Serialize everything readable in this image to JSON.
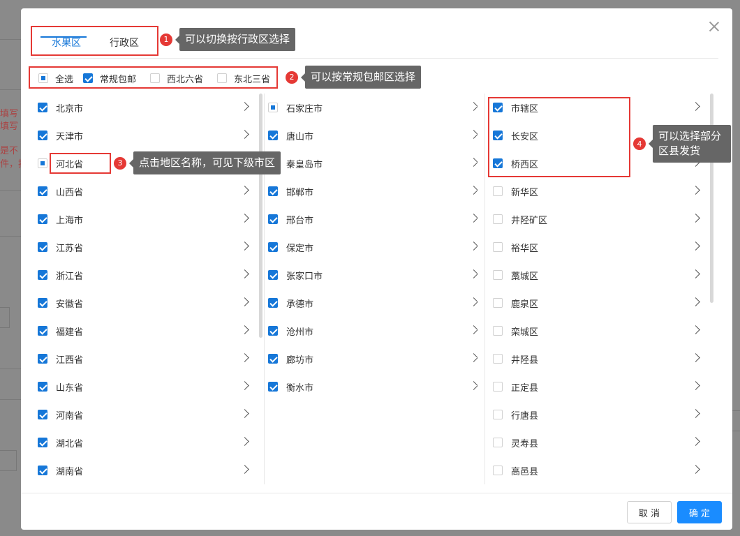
{
  "background": {
    "left_texts": [
      "填写",
      "填写",
      "是不",
      "件，按"
    ]
  },
  "tabs": [
    {
      "label": "水果区",
      "active": true
    },
    {
      "label": "行政区",
      "active": false
    }
  ],
  "filters": [
    {
      "label": "全选",
      "state": "partial"
    },
    {
      "label": "常规包邮",
      "state": "checked"
    },
    {
      "label": "西北六省",
      "state": "unchecked"
    },
    {
      "label": "东北三省",
      "state": "unchecked"
    }
  ],
  "provinces": [
    {
      "name": "北京市",
      "state": "checked"
    },
    {
      "name": "天津市",
      "state": "checked"
    },
    {
      "name": "河北省",
      "state": "partial"
    },
    {
      "name": "山西省",
      "state": "checked"
    },
    {
      "name": "上海市",
      "state": "checked"
    },
    {
      "name": "江苏省",
      "state": "checked"
    },
    {
      "name": "浙江省",
      "state": "checked"
    },
    {
      "name": "安徽省",
      "state": "checked"
    },
    {
      "name": "福建省",
      "state": "checked"
    },
    {
      "name": "江西省",
      "state": "checked"
    },
    {
      "name": "山东省",
      "state": "checked"
    },
    {
      "name": "河南省",
      "state": "checked"
    },
    {
      "name": "湖北省",
      "state": "checked"
    },
    {
      "name": "湖南省",
      "state": "checked"
    }
  ],
  "cities": [
    {
      "name": "石家庄市",
      "state": "partial"
    },
    {
      "name": "唐山市",
      "state": "checked"
    },
    {
      "name": "秦皇岛市",
      "state": "checked"
    },
    {
      "name": "邯郸市",
      "state": "checked"
    },
    {
      "name": "邢台市",
      "state": "checked"
    },
    {
      "name": "保定市",
      "state": "checked"
    },
    {
      "name": "张家口市",
      "state": "checked"
    },
    {
      "name": "承德市",
      "state": "checked"
    },
    {
      "name": "沧州市",
      "state": "checked"
    },
    {
      "name": "廊坊市",
      "state": "checked"
    },
    {
      "name": "衡水市",
      "state": "checked"
    }
  ],
  "districts": [
    {
      "name": "市辖区",
      "state": "checked"
    },
    {
      "name": "长安区",
      "state": "checked"
    },
    {
      "name": "桥西区",
      "state": "checked"
    },
    {
      "name": "新华区",
      "state": "unchecked"
    },
    {
      "name": "井陉矿区",
      "state": "unchecked"
    },
    {
      "name": "裕华区",
      "state": "unchecked"
    },
    {
      "name": "藁城区",
      "state": "unchecked"
    },
    {
      "name": "鹿泉区",
      "state": "unchecked"
    },
    {
      "name": "栾城区",
      "state": "unchecked"
    },
    {
      "name": "井陉县",
      "state": "unchecked"
    },
    {
      "name": "正定县",
      "state": "unchecked"
    },
    {
      "name": "行唐县",
      "state": "unchecked"
    },
    {
      "name": "灵寿县",
      "state": "unchecked"
    },
    {
      "name": "高邑县",
      "state": "unchecked"
    }
  ],
  "callouts": [
    {
      "num": "1",
      "text": "可以切换按行政区选择"
    },
    {
      "num": "2",
      "text": "可以按常规包邮区选择"
    },
    {
      "num": "3",
      "text": "点击地区名称，可见下级市区"
    },
    {
      "num": "4",
      "text": "可以选择部分区县发货"
    }
  ],
  "footer": {
    "cancel_label": "取 消",
    "ok_label": "确 定"
  },
  "colors": {
    "accent": "#1677d8",
    "primary_button": "#1a8cff",
    "annotation_red": "#e53935",
    "tooltip_bg": "#666666"
  }
}
